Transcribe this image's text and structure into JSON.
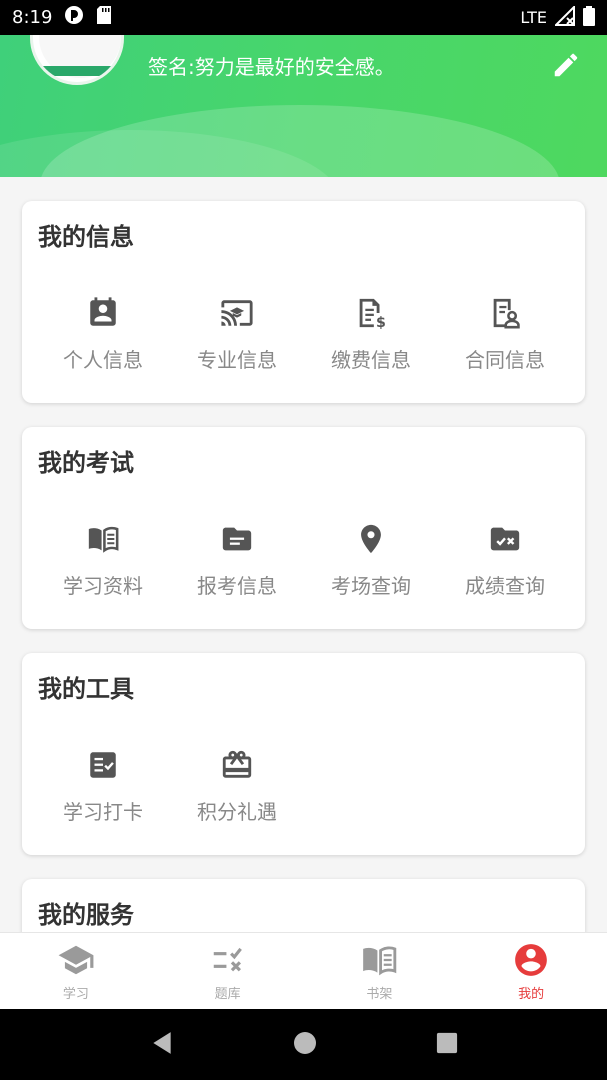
{
  "status_bar": {
    "time": "8:19",
    "network": "LTE"
  },
  "profile": {
    "signature": "签名:努力是最好的安全感。"
  },
  "sections": [
    {
      "title": "我的信息",
      "items": [
        {
          "label": "个人信息",
          "icon": "contact-card-icon"
        },
        {
          "label": "专业信息",
          "icon": "cast-education-icon"
        },
        {
          "label": "缴费信息",
          "icon": "invoice-dollar-icon"
        },
        {
          "label": "合同信息",
          "icon": "contract-person-icon"
        }
      ]
    },
    {
      "title": "我的考试",
      "items": [
        {
          "label": "学习资料",
          "icon": "book-open-icon"
        },
        {
          "label": "报考信息",
          "icon": "folder-list-icon"
        },
        {
          "label": "考场查询",
          "icon": "location-pin-icon"
        },
        {
          "label": "成绩查询",
          "icon": "folder-check-x-icon"
        }
      ]
    },
    {
      "title": "我的工具",
      "items": [
        {
          "label": "学习打卡",
          "icon": "checklist-icon"
        },
        {
          "label": "积分礼遇",
          "icon": "gift-card-icon"
        }
      ]
    },
    {
      "title": "我的服务",
      "items": []
    }
  ],
  "bottom_nav": [
    {
      "label": "学习",
      "icon": "graduation-cap-icon",
      "active": false
    },
    {
      "label": "题库",
      "icon": "question-list-icon",
      "active": false
    },
    {
      "label": "书架",
      "icon": "bookshelf-icon",
      "active": false
    },
    {
      "label": "我的",
      "icon": "account-circle-icon",
      "active": true
    }
  ],
  "colors": {
    "accent": "#48d66b",
    "active_nav": "#e63c3c",
    "icon": "#555555",
    "label": "#888888"
  }
}
